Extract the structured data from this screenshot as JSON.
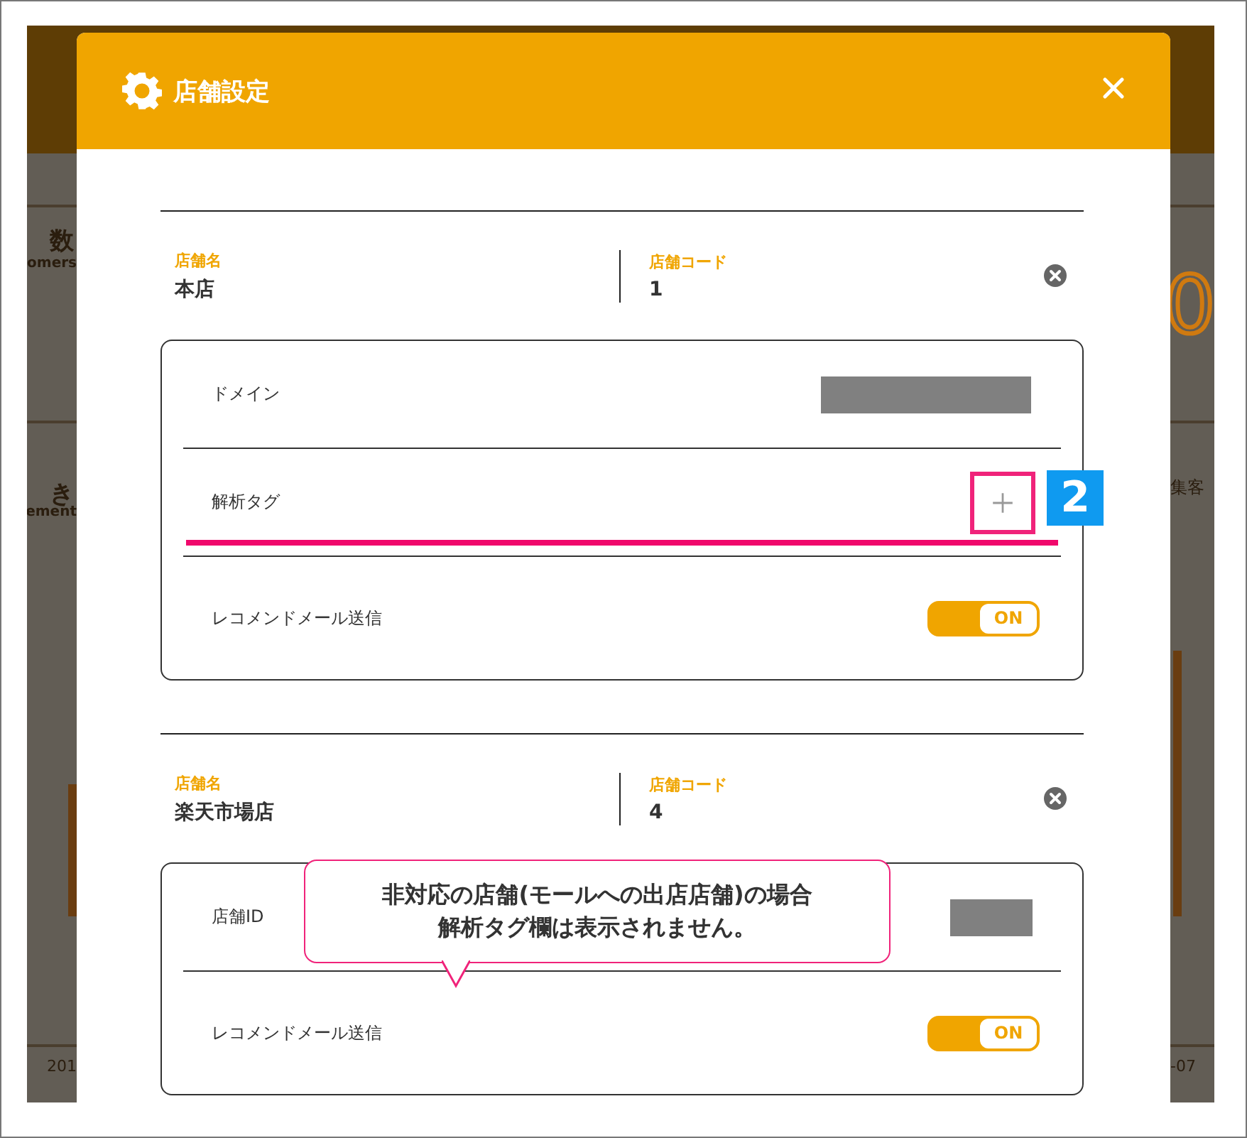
{
  "backdrop": {
    "left_texts": [
      "数",
      "omers",
      "き",
      "ement",
      "201"
    ],
    "right_texts": [
      "0",
      "集客",
      "-07"
    ]
  },
  "dialog": {
    "title": "店舗設定"
  },
  "stores": [
    {
      "name_label": "店舗名",
      "name": "本店",
      "code_label": "店舗コード",
      "code": "1",
      "settings": [
        {
          "kind": "domain",
          "label": "ドメイン"
        },
        {
          "kind": "tag",
          "label": "解析タグ",
          "highlighted": true,
          "badge": "2"
        },
        {
          "kind": "toggle",
          "label": "レコメンドメール送信",
          "toggle_text": "ON",
          "on": true
        }
      ]
    },
    {
      "name_label": "店舗名",
      "name": "楽天市場店",
      "code_label": "店舗コード",
      "code": "4",
      "callout": [
        "非対応の店舗(モールへの出店店舗)の場合",
        "解析タグ欄は表示されません。"
      ],
      "settings": [
        {
          "kind": "id",
          "label": "店舗ID"
        },
        {
          "kind": "toggle",
          "label": "レコメンドメール送信",
          "toggle_text": "ON",
          "on": true
        }
      ]
    }
  ]
}
